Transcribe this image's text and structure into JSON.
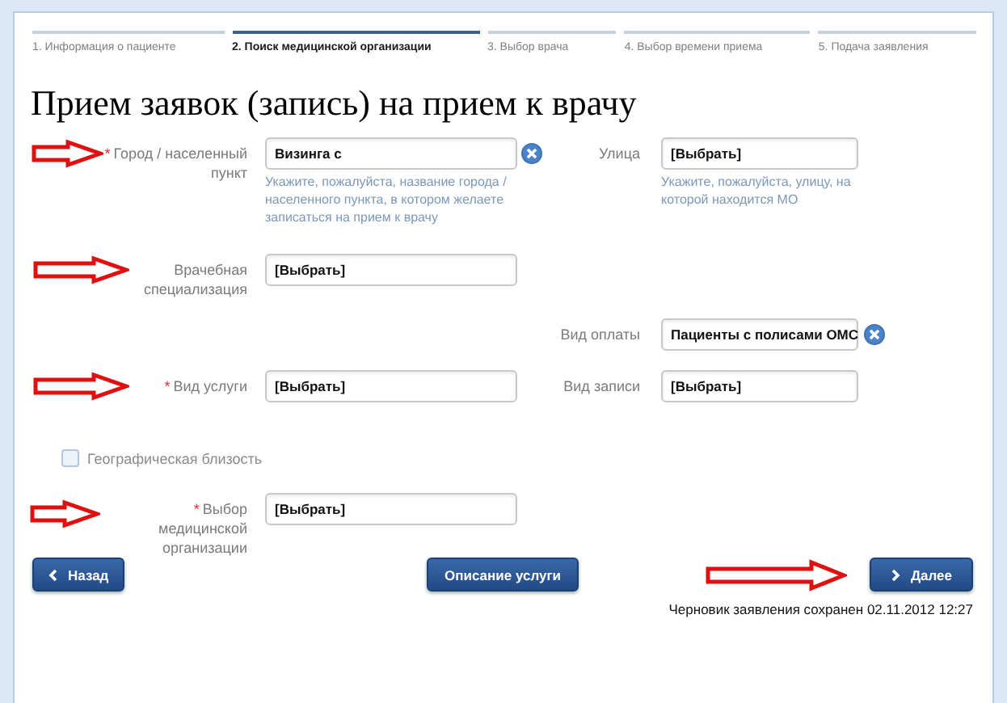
{
  "steps": [
    {
      "label": "1. Информация о пациенте",
      "selected": false
    },
    {
      "label": "2. Поиск медицинской организации",
      "selected": true
    },
    {
      "label": "3. Выбор врача",
      "selected": false
    },
    {
      "label": "4. Выбор времени приема",
      "selected": false
    },
    {
      "label": "5. Подача заявления",
      "selected": false
    }
  ],
  "title": "Прием заявок (запись) на прием к врачу",
  "rows": [
    {
      "kind": "fields",
      "left": {
        "required_mark": "*",
        "label": "Город / населенный пункт",
        "value": "Визинга с",
        "clearable": true,
        "hint": "Укажите, пожалуйста, название города / населенного пункта, в котором желаете записаться на прием к врачу",
        "arrow": true
      },
      "right": {
        "label": "Улица",
        "value": "[Выбрать]",
        "hint": "Укажите, пожалуйста, улицу, на которой находится МО"
      }
    },
    {
      "kind": "fields",
      "left": {
        "label": "Врачебная специализация",
        "value": "[Выбрать]",
        "arrow": true
      }
    },
    {
      "kind": "fields",
      "right": {
        "label": "Вид оплаты",
        "value": "Пациенты с полисами ОМС",
        "clearable": true
      }
    },
    {
      "kind": "fields",
      "left": {
        "required_mark": "*",
        "label": "Вид услуги",
        "value": "[Выбрать]",
        "arrow": true
      },
      "right": {
        "label": "Вид записи",
        "value": "[Выбрать]"
      }
    },
    {
      "kind": "checkbox",
      "label": "Географическая близость",
      "checked": false
    },
    {
      "kind": "fields",
      "left": {
        "required_mark": "*",
        "label": "Выбор медицинской организации",
        "value": "[Выбрать]",
        "arrow": true
      }
    }
  ],
  "footer": {
    "back_button": "Назад",
    "description_button": "Описание услуги",
    "next_button": "Далее",
    "arrow": true,
    "saved_note": "Черновик заявления сохранен 02.11.2012 12:27"
  }
}
